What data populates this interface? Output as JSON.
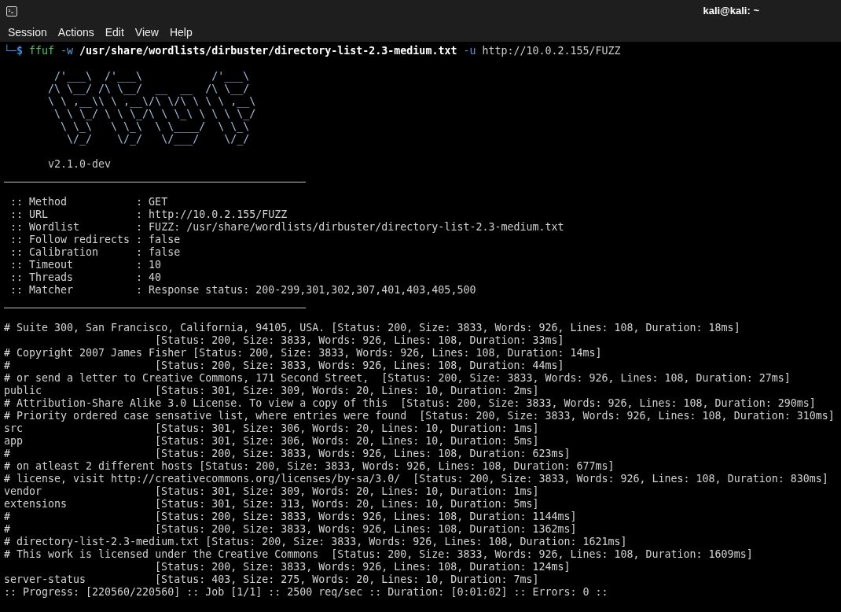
{
  "window": {
    "title": "kali@kali: ~"
  },
  "menu": [
    "Session",
    "Actions",
    "Edit",
    "View",
    "Help"
  ],
  "prompt": {
    "symbol": "└─$",
    "tokens": [
      {
        "text": "ffuf",
        "kind": "command"
      },
      {
        "text": "-w",
        "kind": "flag"
      },
      {
        "text": "/usr/share/wordlists/dirbuster/directory-list-2.3-medium.txt",
        "kind": "path"
      },
      {
        "text": "-u",
        "kind": "flag"
      },
      {
        "text": "http://10.0.2.155/FUZZ",
        "kind": "argument"
      }
    ]
  },
  "banner": {
    "art_lines": [
      "        /'___\\  /'___\\           /'___\\",
      "       /\\ \\__/ /\\ \\__/  __  __  /\\ \\__/",
      "       \\ \\ ,__\\\\ \\ ,__\\/\\ \\/\\ \\ \\ \\ ,__\\",
      "        \\ \\ \\_/ \\ \\ \\_/\\ \\ \\_\\ \\ \\ \\ \\_/",
      "         \\ \\_\\   \\ \\_\\  \\ \\____/  \\ \\_\\",
      "          \\/_/    \\/_/   \\/___/    \\/_/"
    ],
    "version": "v2.1.0-dev"
  },
  "options": [
    ":: Method           : GET",
    ":: URL              : http://10.0.2.155/FUZZ",
    ":: Wordlist         : FUZZ: /usr/share/wordlists/dirbuster/directory-list-2.3-medium.txt",
    ":: Follow redirects : false",
    ":: Calibration      : false",
    ":: Timeout          : 10",
    ":: Threads          : 40",
    ":: Matcher          : Response status: 200-299,301,302,307,401,403,405,500"
  ],
  "results": [
    {
      "name": "# Suite 300, San Francisco, California, 94105, USA.",
      "status": "[Status: 200, Size: 3833, Words: 926, Lines: 108, Duration: 18ms]"
    },
    {
      "status": "[Status: 200, Size: 3833, Words: 926, Lines: 108, Duration: 33ms]"
    },
    {
      "name": "# Copyright 2007 James Fisher",
      "status": "[Status: 200, Size: 3833, Words: 926, Lines: 108, Duration: 14ms]"
    },
    {
      "name": "#",
      "status": "[Status: 200, Size: 3833, Words: 926, Lines: 108, Duration: 44ms]"
    },
    {
      "name": "# or send a letter to Creative Commons, 171 Second Street, ",
      "status": "[Status: 200, Size: 3833, Words: 926, Lines: 108, Duration: 27ms]"
    },
    {
      "name": "public",
      "status": "[Status: 301, Size: 309, Words: 20, Lines: 10, Duration: 2ms]"
    },
    {
      "name": "# Attribution-Share Alike 3.0 License. To view a copy of this ",
      "status": "[Status: 200, Size: 3833, Words: 926, Lines: 108, Duration: 290ms]"
    },
    {
      "name": "# Priority ordered case sensative list, where entries were found ",
      "status": "[Status: 200, Size: 3833, Words: 926, Lines: 108, Duration: 310ms]"
    },
    {
      "name": "src",
      "status": "[Status: 301, Size: 306, Words: 20, Lines: 10, Duration: 1ms]"
    },
    {
      "name": "app",
      "status": "[Status: 301, Size: 306, Words: 20, Lines: 10, Duration: 5ms]"
    },
    {
      "name": "#",
      "status": "[Status: 200, Size: 3833, Words: 926, Lines: 108, Duration: 623ms]"
    },
    {
      "name": "# on atleast 2 different hosts",
      "status": "[Status: 200, Size: 3833, Words: 926, Lines: 108, Duration: 677ms]"
    },
    {
      "name": "# license, visit http://creativecommons.org/licenses/by-sa/3.0/ ",
      "status": "[Status: 200, Size: 3833, Words: 926, Lines: 108, Duration: 830ms]"
    },
    {
      "name": "vendor",
      "status": "[Status: 301, Size: 309, Words: 20, Lines: 10, Duration: 1ms]"
    },
    {
      "name": "extensions",
      "status": "[Status: 301, Size: 313, Words: 20, Lines: 10, Duration: 5ms]"
    },
    {
      "name": "#",
      "status": "[Status: 200, Size: 3833, Words: 926, Lines: 108, Duration: 1144ms]"
    },
    {
      "name": "#",
      "status": "[Status: 200, Size: 3833, Words: 926, Lines: 108, Duration: 1362ms]"
    },
    {
      "name": "# directory-list-2.3-medium.txt",
      "status": "[Status: 200, Size: 3833, Words: 926, Lines: 108, Duration: 1621ms]"
    },
    {
      "name": "# This work is licensed under the Creative Commons ",
      "status": "[Status: 200, Size: 3833, Words: 926, Lines: 108, Duration: 1609ms]"
    },
    {
      "status": "[Status: 200, Size: 3833, Words: 926, Lines: 108, Duration: 124ms]"
    },
    {
      "name": "server-status",
      "status": "[Status: 403, Size: 275, Words: 20, Lines: 10, Duration: 7ms]"
    }
  ],
  "progress": ":: Progress: [220560/220560] :: Job [1/1] :: 2500 req/sec :: Duration: [0:01:02] :: Errors: 0 ::"
}
